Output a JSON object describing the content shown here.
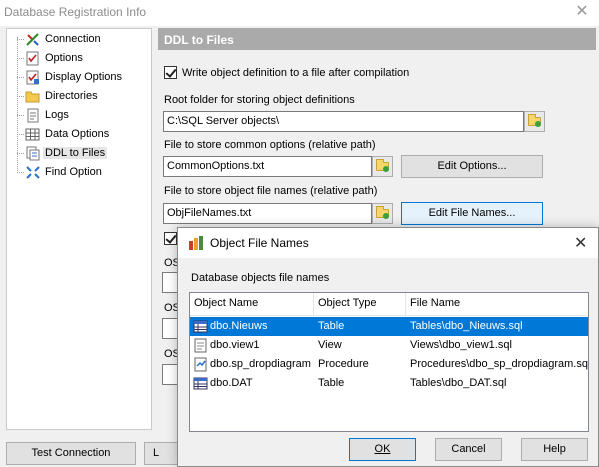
{
  "window": {
    "title": "Database Registration Info",
    "close_symbol": "✕"
  },
  "sidebar": {
    "items": [
      {
        "label": "Connection",
        "icon": "connection-icon"
      },
      {
        "label": "Options",
        "icon": "options-checklist-icon"
      },
      {
        "label": "Display Options",
        "icon": "display-options-icon"
      },
      {
        "label": "Directories",
        "icon": "folder-icon"
      },
      {
        "label": "Logs",
        "icon": "log-icon"
      },
      {
        "label": "Data Options",
        "icon": "grid-icon"
      },
      {
        "label": "DDL to Files",
        "icon": "ddl-file-icon",
        "selected": true
      },
      {
        "label": "Find Option",
        "icon": "find-arrows-icon"
      }
    ]
  },
  "panel": {
    "heading": "DDL to Files",
    "write_checkbox_label": "Write object definition to a file after compilation",
    "write_checked": true,
    "root_label": "Root folder for storing object definitions",
    "root_value": "C:\\SQL Server objects\\",
    "common_label": "File to store common options (relative path)",
    "common_value": "CommonOptions.txt",
    "edit_options_label": "Edit Options...",
    "names_label": "File to store object file names (relative path)",
    "names_value": "ObjFileNames.txt",
    "edit_file_names_label": "Edit File Names...",
    "os_label": "OS"
  },
  "footer": {
    "test_connection_label": "Test Connection",
    "partial_button_label": "L"
  },
  "dialog": {
    "title": "Object File Names",
    "close_symbol": "✕",
    "subtitle": "Database objects file names",
    "columns": [
      "Object Name",
      "Object Type",
      "File Name"
    ],
    "rows": [
      {
        "name": "dbo.Nieuws",
        "type": "Table",
        "file": "Tables\\dbo_Nieuws.sql",
        "icon": "table-icon",
        "selected": true
      },
      {
        "name": "dbo.view1",
        "type": "View",
        "file": "Views\\dbo_view1.sql",
        "icon": "view-icon",
        "selected": false
      },
      {
        "name": "dbo.sp_dropdiagram",
        "type": "Procedure",
        "file": "Procedures\\dbo_sp_dropdiagram.sql",
        "icon": "procedure-icon",
        "selected": false
      },
      {
        "name": "dbo.DAT",
        "type": "Table",
        "file": "Tables\\dbo_DAT.sql",
        "icon": "table-icon",
        "selected": false
      }
    ],
    "ok_label": "OK",
    "cancel_label": "Cancel",
    "help_label": "Help"
  }
}
